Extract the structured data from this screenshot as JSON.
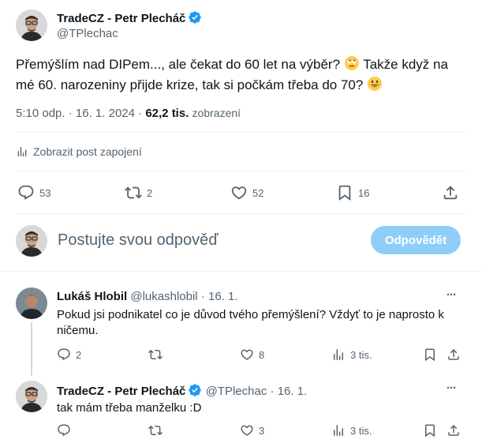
{
  "main_post": {
    "author_name": "TradeCZ - Petr Plecháč",
    "handle": "@TPlechac",
    "text_part1": "Přemýšlím nad DIPem..., ale čekat do 60 let na výběr?",
    "text_part2": "Takže když na mé 60. narozeniny přijde krize, tak si počkám třeba do 70?",
    "emoji1": "rolling-eyes-emoji",
    "emoji2": "grinning-emoji",
    "time": "5:10 odp.",
    "separator": "·",
    "date": "16. 1. 2024",
    "views_count": "62,2 tis.",
    "views_label": "zobrazení",
    "engagement_link": "Zobrazit post zapojení",
    "replies": "53",
    "reposts": "2",
    "likes": "52",
    "bookmarks": "16"
  },
  "composer": {
    "placeholder": "Postujte svou odpověď",
    "reply_button": "Odpovědět"
  },
  "replies": [
    {
      "author_name": "Lukáš Hlobil",
      "handle": "@lukashlobil",
      "separator": "·",
      "date": "16. 1.",
      "text": "Pokud jsi podnikatel co je důvod tvého přemýšlení? Vždyť to je naprosto k ničemu.",
      "replies": "2",
      "reposts": "",
      "likes": "8",
      "views": "3 tis.",
      "more": "···"
    },
    {
      "author_name": "TradeCZ - Petr Plecháč",
      "handle": "@TPlechac",
      "separator": "·",
      "date": "16. 1.",
      "text": "tak mám třeba manželku :D",
      "replies": "",
      "reposts": "",
      "likes": "3",
      "views": "3 tis.",
      "more": "···"
    }
  ],
  "colors": {
    "verified": "#1d9bf0",
    "muted": "#536471",
    "divider": "#eff3f4",
    "reply_button_disabled": "#8ecdf8"
  }
}
